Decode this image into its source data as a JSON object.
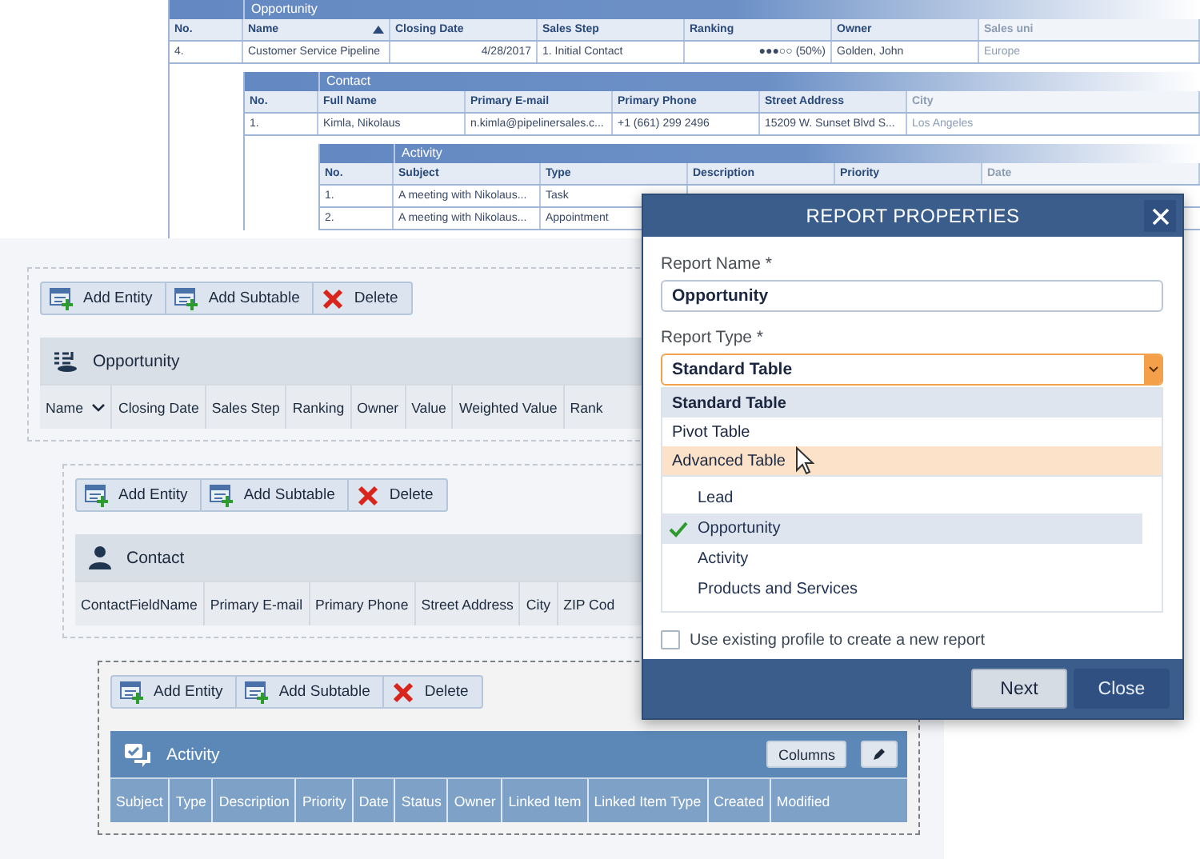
{
  "preview": {
    "tables": [
      {
        "title": "Opportunity",
        "columns": [
          {
            "label": "No.",
            "sorted": false,
            "numeric": false,
            "faded": false
          },
          {
            "label": "Name",
            "sorted": true,
            "numeric": false,
            "faded": false
          },
          {
            "label": "Closing Date",
            "sorted": false,
            "numeric": true,
            "faded": false
          },
          {
            "label": "Sales Step",
            "sorted": false,
            "numeric": false,
            "faded": false
          },
          {
            "label": "Ranking",
            "sorted": false,
            "numeric": true,
            "faded": false
          },
          {
            "label": "Owner",
            "sorted": false,
            "numeric": false,
            "faded": false
          },
          {
            "label": "Sales uni",
            "sorted": false,
            "numeric": false,
            "faded": true
          }
        ],
        "rows": [
          [
            "4.",
            "Customer Service Pipeline",
            "4/28/2017",
            "1. Initial Contact",
            "●●●○○ (50%)",
            "Golden, John",
            "Europe"
          ]
        ]
      },
      {
        "title": "Contact",
        "columns": [
          {
            "label": "No.",
            "sorted": false,
            "faded": false
          },
          {
            "label": "Full Name",
            "sorted": false,
            "faded": false
          },
          {
            "label": "Primary E-mail",
            "sorted": false,
            "faded": false
          },
          {
            "label": "Primary Phone",
            "sorted": false,
            "faded": false
          },
          {
            "label": "Street Address",
            "sorted": false,
            "faded": false
          },
          {
            "label": "City",
            "sorted": false,
            "faded": true
          }
        ],
        "rows": [
          [
            "1.",
            "Kimla, Nikolaus",
            "n.kimla@pipelinersales.c...",
            "+1 (661) 299 2496",
            "15209 W. Sunset Blvd S...",
            "Los Angeles"
          ]
        ]
      },
      {
        "title": "Activity",
        "columns": [
          {
            "label": "No.",
            "sorted": false,
            "faded": false
          },
          {
            "label": "Subject",
            "sorted": false,
            "faded": false
          },
          {
            "label": "Type",
            "sorted": false,
            "faded": false
          },
          {
            "label": "Description",
            "sorted": false,
            "faded": false
          },
          {
            "label": "Priority",
            "sorted": false,
            "faded": false
          },
          {
            "label": "Date",
            "sorted": false,
            "faded": true
          }
        ],
        "rows": [
          [
            "1.",
            "A meeting with Nikolaus...",
            "Task"
          ],
          [
            "2.",
            "A meeting with Nikolaus...",
            "Appointment"
          ]
        ]
      }
    ]
  },
  "designer": {
    "sections": [
      {
        "kind": "opportunity",
        "title": "Opportunity",
        "selected": false,
        "toolbar": [
          {
            "kind": "add",
            "label": "Add Entity"
          },
          {
            "kind": "add",
            "label": "Add Subtable"
          },
          {
            "kind": "delete",
            "label": "Delete"
          }
        ],
        "columns": [
          {
            "label": "Name",
            "menu": true
          },
          {
            "label": "Closing Date",
            "menu": false
          },
          {
            "label": "Sales Step",
            "menu": false
          },
          {
            "label": "Ranking",
            "menu": false
          },
          {
            "label": "Owner",
            "menu": false
          },
          {
            "label": "Value",
            "menu": false
          },
          {
            "label": "Weighted Value",
            "menu": false
          },
          {
            "label": "Rank",
            "menu": false
          }
        ]
      },
      {
        "kind": "contact",
        "title": "Contact",
        "selected": false,
        "toolbar": [
          {
            "kind": "add",
            "label": "Add Entity"
          },
          {
            "kind": "add",
            "label": "Add Subtable"
          },
          {
            "kind": "delete",
            "label": "Delete"
          }
        ],
        "columns": [
          {
            "label": "ContactFieldName",
            "menu": false
          },
          {
            "label": "Primary E-mail",
            "menu": false
          },
          {
            "label": "Primary Phone",
            "menu": false
          },
          {
            "label": "Street Address",
            "menu": false
          },
          {
            "label": "City",
            "menu": false
          },
          {
            "label": "ZIP Cod",
            "menu": false
          }
        ]
      },
      {
        "kind": "activity",
        "title": "Activity",
        "selected": true,
        "columns_button": "Columns",
        "toolbar": [
          {
            "kind": "add",
            "label": "Add Entity"
          },
          {
            "kind": "add",
            "label": "Add Subtable"
          },
          {
            "kind": "delete",
            "label": "Delete"
          }
        ],
        "columns": [
          {
            "label": "Subject",
            "menu": false
          },
          {
            "label": "Type",
            "menu": false
          },
          {
            "label": "Description",
            "menu": false
          },
          {
            "label": "Priority",
            "menu": false
          },
          {
            "label": "Date",
            "menu": false
          },
          {
            "label": "Status",
            "menu": false
          },
          {
            "label": "Owner",
            "menu": false
          },
          {
            "label": "Linked Item",
            "menu": false
          },
          {
            "label": "Linked Item Type",
            "menu": false
          },
          {
            "label": "Created",
            "menu": false
          },
          {
            "label": "Modified",
            "menu": false
          }
        ]
      }
    ]
  },
  "dialog": {
    "title": "REPORT PROPERTIES",
    "name_label": "Report Name *",
    "name_value": "Opportunity",
    "type_label": "Report Type *",
    "type_value": "Standard Table",
    "expanded": true,
    "type_options": [
      {
        "label": "Standard Table",
        "selected": true,
        "hovered": false
      },
      {
        "label": "Pivot Table",
        "selected": false,
        "hovered": false
      },
      {
        "label": "Advanced Table",
        "selected": false,
        "hovered": true
      }
    ],
    "entities": [
      {
        "label": "Lead",
        "checked": false
      },
      {
        "label": "Opportunity",
        "checked": true
      },
      {
        "label": "Activity",
        "checked": false
      },
      {
        "label": "Products and Services",
        "checked": false
      }
    ],
    "reuse": {
      "label": "Use existing profile to create a new report",
      "checked": false
    },
    "buttons": [
      {
        "label": "Next",
        "primary": true
      },
      {
        "label": "Close",
        "primary": false
      }
    ]
  }
}
